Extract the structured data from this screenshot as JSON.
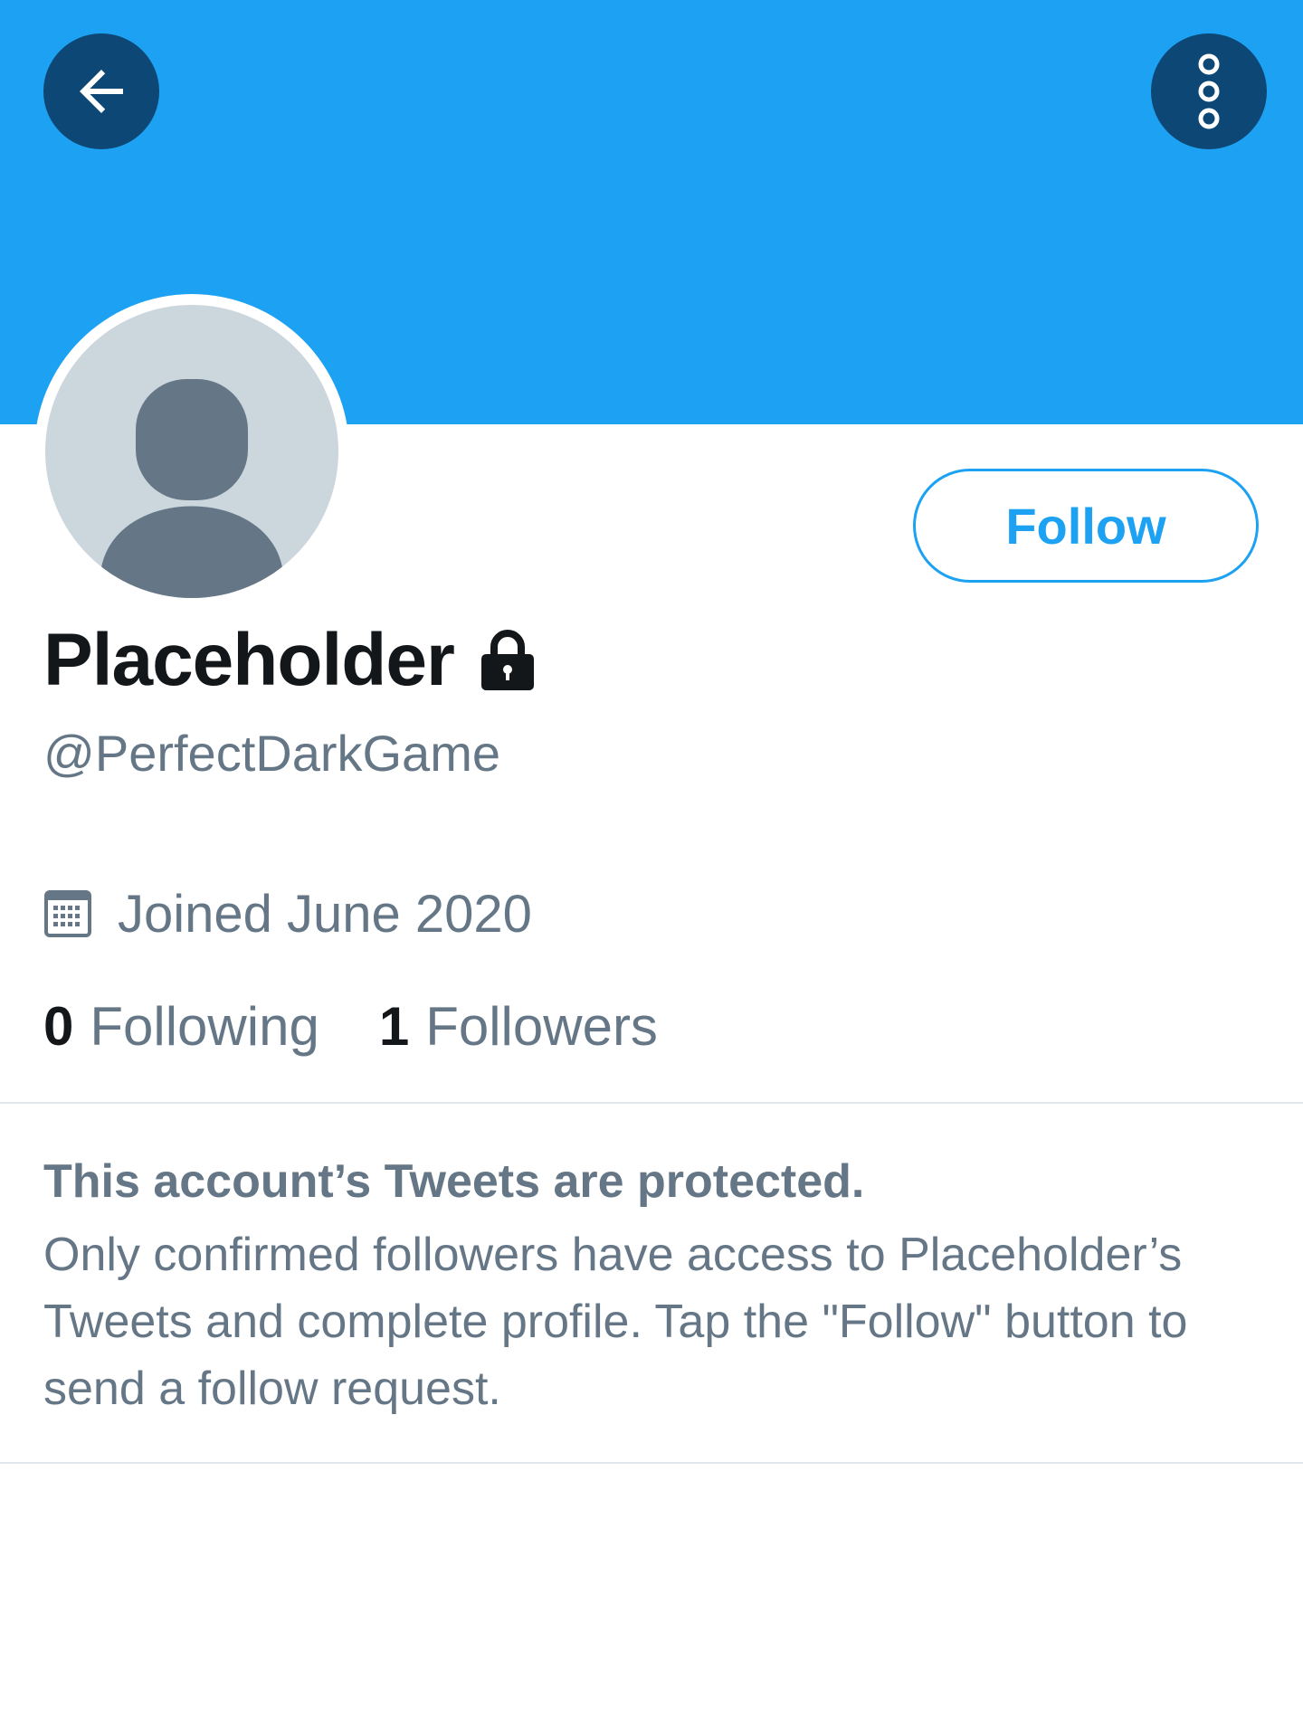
{
  "header": {
    "back_icon": "arrow-left-icon",
    "more_icon": "more-vertical-icon",
    "banner_color": "#1da1f2"
  },
  "profile": {
    "avatar_icon": "default-avatar-icon",
    "display_name": "Placeholder",
    "protected_icon": "lock-icon",
    "handle": "@PerfectDarkGame",
    "joined_icon": "calendar-icon",
    "joined": "Joined June 2020",
    "follow_button_label": "Follow"
  },
  "stats": {
    "following_count": "0",
    "following_label": "Following",
    "followers_count": "1",
    "followers_label": "Followers"
  },
  "protected_notice": {
    "title": "This account’s Tweets are protected.",
    "body": "Only confirmed followers have access to Placeholder’s Tweets and complete profile. Tap the \"Follow\" button to send a follow request."
  },
  "colors": {
    "accent": "#1da1f2",
    "secondary_text": "#657786",
    "primary_text": "#14171a"
  }
}
